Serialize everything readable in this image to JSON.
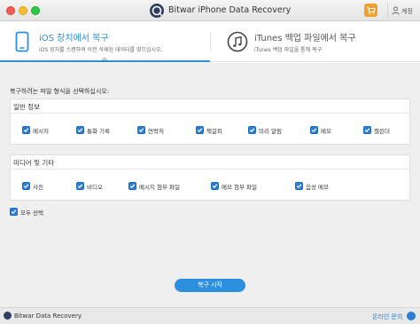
{
  "window": {
    "title": "Bitwar iPhone Data Recovery"
  },
  "header": {
    "account_label": "계정"
  },
  "tabs": [
    {
      "title": "iOS 장치에서 복구",
      "subtitle": "iOS 장치를 스캔하여 이전 삭제된 데이터를 찾으십시오."
    },
    {
      "title": "iTunes 백업 파일에서 복구",
      "subtitle": "iTunes 백업 파일을 통해 복구"
    }
  ],
  "instruction": "복구하려는 파일 형식을 선택하십시오:",
  "groups": [
    {
      "title": "일반 정보",
      "items": [
        {
          "label": "메시지",
          "checked": true
        },
        {
          "label": "통화 기록",
          "checked": true
        },
        {
          "label": "연락처",
          "checked": true
        },
        {
          "label": "책갈피",
          "checked": true
        },
        {
          "label": "미리 알림",
          "checked": true
        },
        {
          "label": "메모",
          "checked": true
        },
        {
          "label": "캘린더",
          "checked": true
        }
      ]
    },
    {
      "title": "미디어 및 기타",
      "items": [
        {
          "label": "사진",
          "checked": true
        },
        {
          "label": "비디오",
          "checked": true
        },
        {
          "label": "메시지 첨부 파일",
          "checked": true
        },
        {
          "label": "메모 첨부 파일",
          "checked": true
        },
        {
          "label": "음성 메모",
          "checked": true
        }
      ]
    }
  ],
  "select_all": {
    "label": "모두 선택",
    "checked": true
  },
  "recover_button": "복구 시작",
  "footer": {
    "brand": "Bitwar Data Recovery",
    "online_help": "온라인 문의"
  },
  "colors": {
    "accent": "#2a8fdc",
    "checkbox": "#2a7fd4",
    "cart": "#f0a12c"
  },
  "icons": {
    "app": "bitwar-logo-icon",
    "cart": "cart-icon",
    "account": "user-icon",
    "ios_tab": "phone-icon",
    "itunes_tab": "music-note-icon",
    "help": "help-icon"
  }
}
